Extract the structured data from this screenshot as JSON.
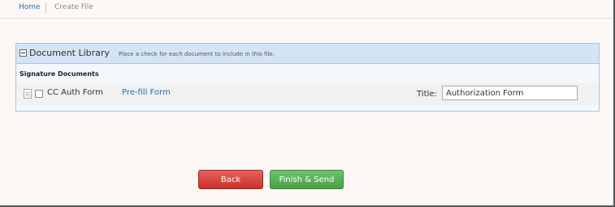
{
  "nav": {
    "home": "Home",
    "create_file": "Create File"
  },
  "library": {
    "title": "Document Library",
    "hint": "Place a check for each document to include in this file.",
    "section_title": "Signature Documents",
    "documents": [
      {
        "name": "CC Auth Form",
        "prefill_label": "Pre-fill Form",
        "title_label": "Title:",
        "title_value": "Authorization Form",
        "checked": false
      }
    ]
  },
  "actions": {
    "back_label": "Back",
    "finish_label": "Finish & Send"
  },
  "colors": {
    "link": "#2a6db0",
    "back_button": "#c9302c",
    "finish_button": "#4a9f45",
    "panel_header": "#d4e4f3"
  }
}
